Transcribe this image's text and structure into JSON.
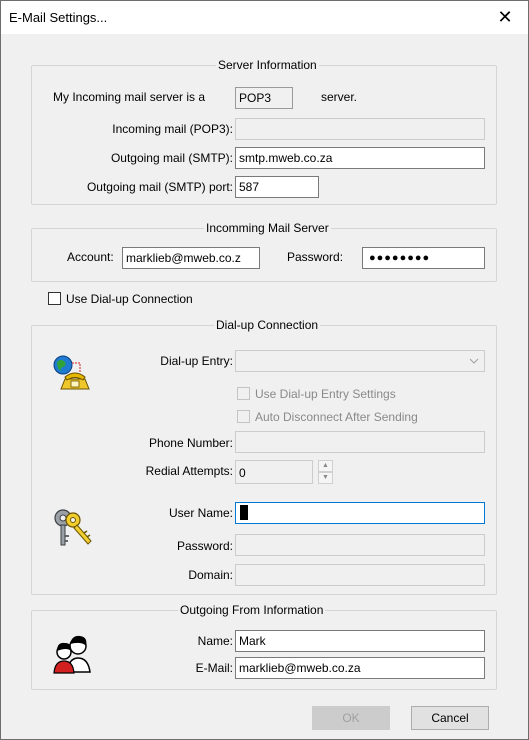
{
  "window": {
    "title": "E-Mail Settings...",
    "close_glyph": "✕"
  },
  "server_info": {
    "legend": "Server Information",
    "incoming_type_prefix": "My Incoming mail server is a",
    "incoming_type_value": "POP3",
    "incoming_type_suffix": "server.",
    "incoming_label": "Incoming mail (POP3):",
    "incoming_value": "",
    "outgoing_label": "Outgoing mail (SMTP):",
    "outgoing_value": "smtp.mweb.co.za",
    "port_label": "Outgoing mail (SMTP) port:",
    "port_value": "587"
  },
  "incoming_server": {
    "legend": "Incomming Mail Server",
    "account_label": "Account:",
    "account_value": "marklieb@mweb.co.z",
    "password_label": "Password:",
    "password_value": "●●●●●●●●"
  },
  "use_dialup": {
    "label": "Use Dial-up Connection",
    "checked": false
  },
  "dialup": {
    "legend": "Dial-up Connection",
    "entry_label": "Dial-up Entry:",
    "entry_value": "",
    "use_entry_settings_label": "Use Dial-up Entry Settings",
    "auto_disconnect_label": "Auto Disconnect After Sending",
    "phone_label": "Phone Number:",
    "phone_value": "",
    "redial_label": "Redial Attempts:",
    "redial_value": "0",
    "username_label": "User Name:",
    "username_value": "",
    "password_label": "Password:",
    "password_value": "",
    "domain_label": "Domain:",
    "domain_value": ""
  },
  "outgoing_from": {
    "legend": "Outgoing From Information",
    "name_label": "Name:",
    "name_value": "Mark",
    "email_label": "E-Mail:",
    "email_value": "marklieb@mweb.co.za"
  },
  "buttons": {
    "ok_label": "OK",
    "cancel_label": "Cancel"
  },
  "icons": {
    "dialup": "globe-phone-icon",
    "keys": "keys-icon",
    "people": "people-icon",
    "dropdown": "chevron-down-icon"
  },
  "colors": {
    "focus_border": "#0078d7",
    "dialog_bg": "#f0f0f0"
  }
}
